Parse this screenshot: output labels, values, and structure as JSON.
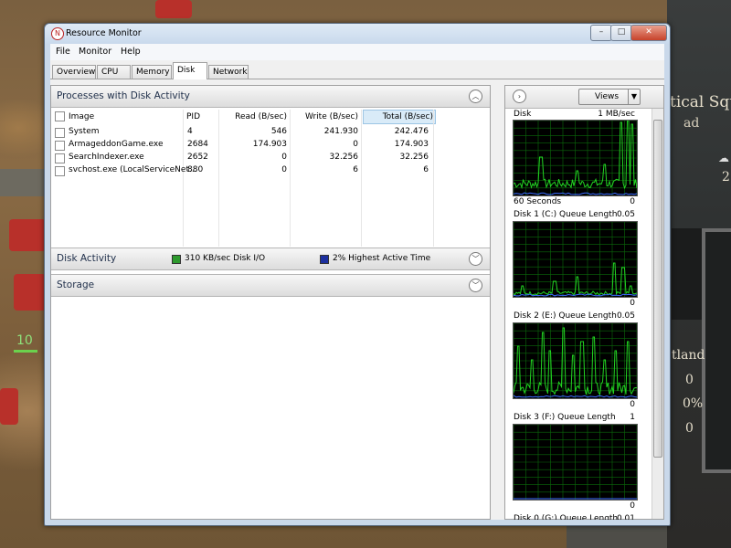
{
  "window": {
    "title": "Resource Monitor",
    "minimize_glyph": "–",
    "maximize_glyph": "□",
    "close_glyph": "✕"
  },
  "menu": [
    "File",
    "Monitor",
    "Help"
  ],
  "tabs": [
    {
      "label": "Overview",
      "active": false
    },
    {
      "label": "CPU",
      "active": false
    },
    {
      "label": "Memory",
      "active": false
    },
    {
      "label": "Disk",
      "active": true
    },
    {
      "label": "Network",
      "active": false
    }
  ],
  "processes": {
    "title": "Processes with Disk Activity",
    "columns": {
      "image": "Image",
      "pid": "PID",
      "read": "Read (B/sec)",
      "write": "Write (B/sec)",
      "total": "Total (B/sec)"
    },
    "rows": [
      {
        "image": "System",
        "pid": "4",
        "read": "546",
        "write": "241.930",
        "total": "242.476"
      },
      {
        "image": "ArmageddonGame.exe",
        "pid": "2684",
        "read": "174.903",
        "write": "0",
        "total": "174.903"
      },
      {
        "image": "SearchIndexer.exe",
        "pid": "2652",
        "read": "0",
        "write": "32.256",
        "total": "32.256"
      },
      {
        "image": "svchost.exe (LocalServiceNet...",
        "pid": "880",
        "read": "0",
        "write": "6",
        "total": "6"
      }
    ]
  },
  "disk_activity": {
    "title": "Disk Activity",
    "io_text": "310 KB/sec Disk I/O",
    "active_time_text": "2% Highest Active Time",
    "io_color": "#2e9a2e",
    "active_color": "#1c2f9e"
  },
  "storage": {
    "title": "Storage"
  },
  "right_panel": {
    "views_label": "Views",
    "graphs": [
      {
        "label": "Disk",
        "max": "1 MB/sec",
        "footer_left": "60 Seconds",
        "footer_right": "0"
      },
      {
        "label": "Disk 1 (C:) Queue Length",
        "max": "0.05",
        "footer_left": "",
        "footer_right": "0"
      },
      {
        "label": "Disk 2 (E:) Queue Length",
        "max": "0.05",
        "footer_left": "",
        "footer_right": "0"
      },
      {
        "label": "Disk 3 (F:) Queue Length",
        "max": "1",
        "footer_left": "",
        "footer_right": "0"
      },
      {
        "label": "Disk 0 (G:) Queue Length",
        "max": "0.01",
        "footer_left": "",
        "footer_right": ""
      }
    ]
  },
  "game": {
    "panel_title": "tical Squ",
    "panel_sub": "ad",
    "unit_count": "10",
    "stat_1": "2",
    "stat_label": "tland",
    "stat_values": [
      "0",
      "0%",
      "0"
    ]
  },
  "colors": {
    "graph_green": "#22d422",
    "graph_grid": "#0b6a0b",
    "graph_blue": "#3a6bff"
  }
}
